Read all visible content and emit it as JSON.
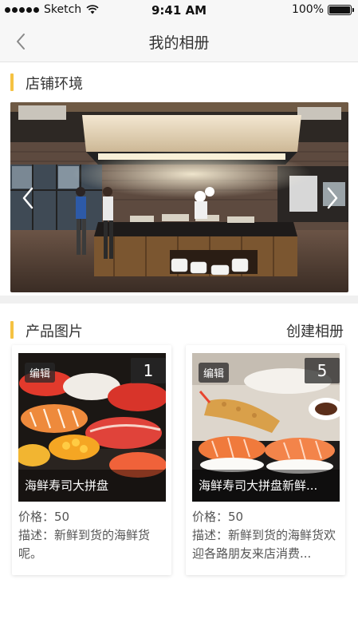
{
  "status_bar": {
    "carrier": "Sketch",
    "time": "9:41 AM",
    "battery": "100%",
    "icons": [
      "signal-dots-icon",
      "wifi-icon",
      "battery-icon"
    ]
  },
  "nav": {
    "title": "我的相册",
    "back_icon": "chevron-left-icon"
  },
  "store_section": {
    "title": "店铺环境",
    "accent_color": "#f5c242",
    "prev_icon": "chevron-left-icon",
    "next_icon": "chevron-right-icon"
  },
  "products_section": {
    "title": "产品图片",
    "create_label": "创建相册",
    "items": [
      {
        "edit_label": "编辑",
        "count": "1",
        "name": "海鲜寿司大拼盘",
        "price_label": "价格：",
        "price": "50",
        "desc_label": "描述：",
        "desc": "新鲜到货的海鲜货呢。"
      },
      {
        "edit_label": "编辑",
        "count": "5",
        "name": "海鲜寿司大拼盘新鲜...",
        "price_label": "价格：",
        "price": "50",
        "desc_label": "描述：",
        "desc": "新鲜到货的海鲜货欢迎各路朋友来店消费..."
      }
    ]
  }
}
